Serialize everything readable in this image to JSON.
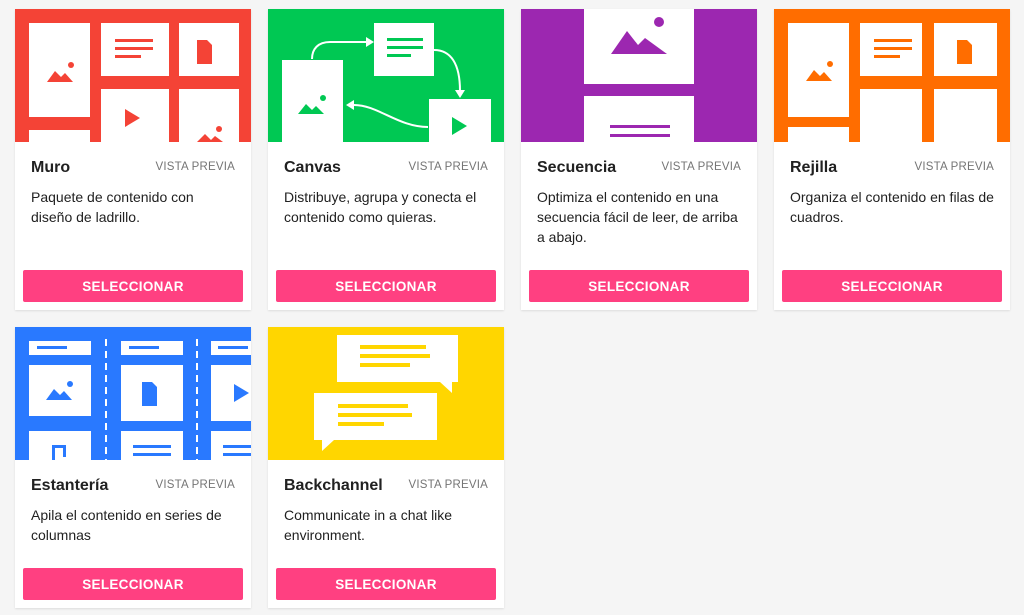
{
  "preview_label": "VISTA PREVIA",
  "select_label": "SELECCIONAR",
  "cards": [
    {
      "title": "Muro",
      "description": "Paquete de contenido con diseño de ladrillo.",
      "color": "#f44336"
    },
    {
      "title": "Canvas",
      "description": "Distribuye, agrupa y conecta el contenido como quieras.",
      "color": "#00c853"
    },
    {
      "title": "Secuencia",
      "description": "Optimiza el contenido en una secuencia fácil de leer, de arriba a abajo.",
      "color": "#9c27b0"
    },
    {
      "title": "Rejilla",
      "description": "Organiza el contenido en filas de cuadros.",
      "color": "#ff6d00"
    },
    {
      "title": "Estantería",
      "description": "Apila el contenido en series de columnas",
      "color": "#2979ff"
    },
    {
      "title": "Backchannel",
      "description": "Communicate in a chat like environment.",
      "color": "#ffd600"
    }
  ],
  "button_color": "#ff4081"
}
